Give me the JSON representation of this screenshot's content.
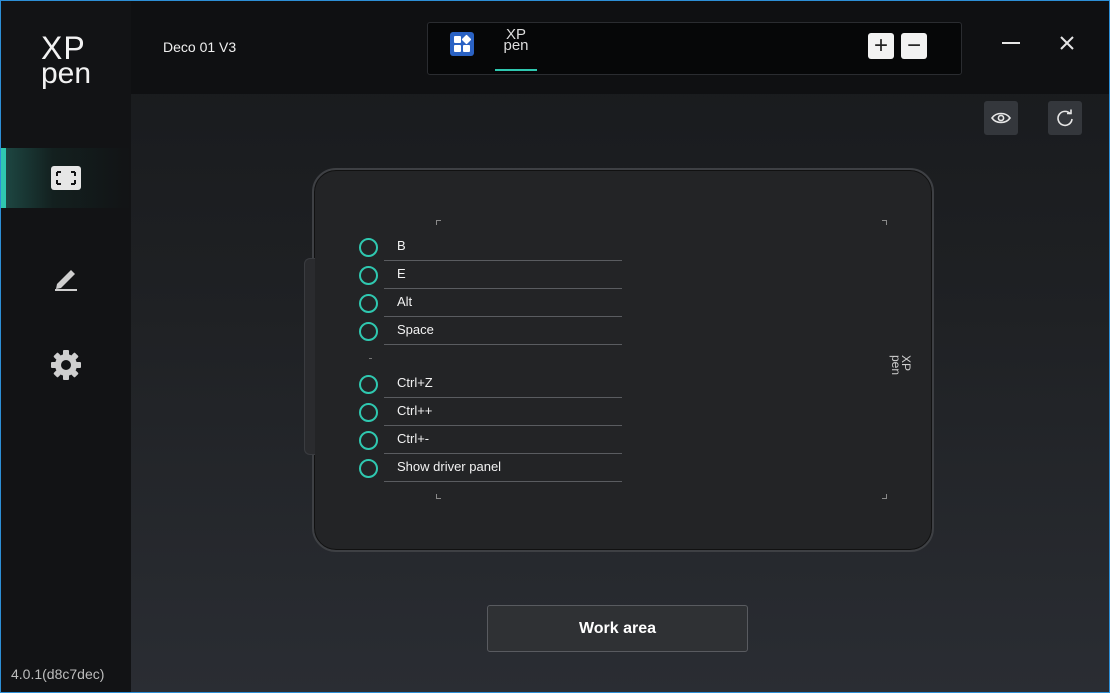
{
  "app": {
    "logo_line1": "XP",
    "logo_line2": "pen",
    "device_name": "Deco 01 V3",
    "version": "4.0.1(d8c7dec)"
  },
  "tabs": {
    "app_tab_xp_line1": "XP",
    "app_tab_xp_line2": "pen",
    "add_label": "+",
    "remove_label": "−"
  },
  "sidebar": {
    "items": [
      {
        "name": "work-area",
        "icon": "frame-icon",
        "active": true
      },
      {
        "name": "pen",
        "icon": "pen-icon",
        "active": false
      },
      {
        "name": "settings",
        "icon": "gear-icon",
        "active": false
      }
    ]
  },
  "tablet": {
    "brand_line1": "XP",
    "brand_line2": "pen",
    "keys": [
      "B",
      "E",
      "Alt",
      "Space",
      "Ctrl+Z",
      "Ctrl++",
      "Ctrl+-",
      "Show driver panel"
    ]
  },
  "buttons": {
    "work_area": "Work area"
  },
  "colors": {
    "accent": "#2fc8b0",
    "tab_blue": "#2a62c4",
    "frame_border": "#2d8fd6"
  }
}
